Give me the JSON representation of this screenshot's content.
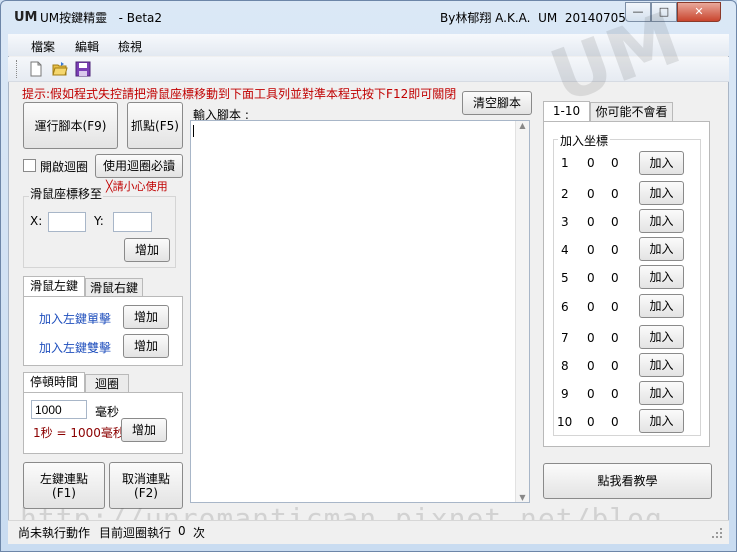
{
  "window": {
    "app_icon_text": "UM",
    "title": "UM按鍵精靈   - Beta2",
    "author": "By林郁翔 A.K.A.  UM  20140705",
    "controls": {
      "minimize": "—",
      "maximize": "□",
      "close": "✕"
    }
  },
  "menu": {
    "items": [
      "檔案",
      "編輯",
      "檢視"
    ]
  },
  "toolbar": {
    "icons": [
      "new-file-icon",
      "open-folder-icon",
      "save-icon"
    ]
  },
  "hint": "提示:假如程式失控請把滑鼠座標移動到下面工具列並對準本程式按下F12即可關閉",
  "left": {
    "run_button": "運行腳本(F9)",
    "capture_button": "抓點(F5)",
    "loop_checkbox_label": "開啟迴圈",
    "loop_checked": false,
    "loop_help_button": "使用迴圈必讀",
    "mouse_move_title": "滑鼠座標移至",
    "warning": "╳請小心使用",
    "x_label": "X:",
    "y_label": "Y:",
    "x_value": "",
    "y_value": "",
    "add_button": "增加",
    "mouse_tabs": [
      "滑鼠左鍵",
      "滑鼠右鍵"
    ],
    "left_single_label": "加入左鍵單擊",
    "left_double_label": "加入左鍵雙擊",
    "add_single": "增加",
    "add_double": "增加",
    "wait_tabs": [
      "停頓時間",
      "迴圈"
    ],
    "wait_value": "1000",
    "ms_label": "毫秒",
    "ms_note": "1秒 = 1000毫秒",
    "add_wait": "增加",
    "burst_left_button": "左鍵連點\n(F1)",
    "cancel_burst_button": "取消連點\n(F2)"
  },
  "script": {
    "label": "輸入腳本 :",
    "content": "",
    "clear_button": "清空腳本"
  },
  "right": {
    "tabs": [
      "1-10",
      "你可能不會看"
    ],
    "group_title": "加入坐標",
    "rows": [
      {
        "n": "1",
        "x": "0",
        "y": "0",
        "btn": "加入"
      },
      {
        "n": "2",
        "x": "0",
        "y": "0",
        "btn": "加入"
      },
      {
        "n": "3",
        "x": "0",
        "y": "0",
        "btn": "加入"
      },
      {
        "n": "4",
        "x": "0",
        "y": "0",
        "btn": "加入"
      },
      {
        "n": "5",
        "x": "0",
        "y": "0",
        "btn": "加入"
      },
      {
        "n": "6",
        "x": "0",
        "y": "0",
        "btn": "加入"
      },
      {
        "n": "7",
        "x": "0",
        "y": "0",
        "btn": "加入"
      },
      {
        "n": "8",
        "x": "0",
        "y": "0",
        "btn": "加入"
      },
      {
        "n": "9",
        "x": "0",
        "y": "0",
        "btn": "加入"
      },
      {
        "n": "10",
        "x": "0",
        "y": "0",
        "btn": "加入"
      }
    ],
    "tutorial_button": "點我看教學"
  },
  "status": {
    "text1": "尚未執行動作",
    "text2": "目前迴圈執行",
    "count": "0",
    "unit": "次"
  },
  "watermark": "http://unromanticman.pixnet.net/blog",
  "watermark_logo": "UM"
}
